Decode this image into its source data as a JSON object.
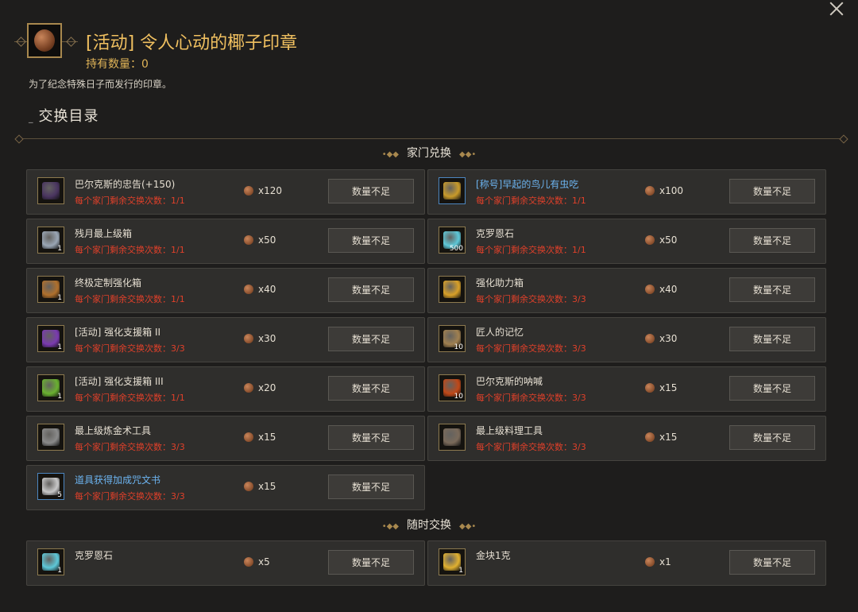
{
  "header": {
    "title": "[活动] 令人心动的椰子印章",
    "count_label": "持有数量：0",
    "description": "为了纪念特殊日子而发行的印章。",
    "icon": "coconut-seal-icon"
  },
  "section": {
    "title": "交换目录"
  },
  "groups": {
    "family": {
      "title": "家门兑换"
    },
    "anytime": {
      "title": "随时交换"
    }
  },
  "items": [
    {
      "name": "巴尔克斯的忠告(+150)",
      "remain": "每个家门剩余交换次数：1/1",
      "cost": "x120",
      "button": "数量不足",
      "badge": "",
      "icon": "scroll-icon",
      "highlight": false,
      "color": "#4a3560"
    },
    {
      "name": "[称号]早起的鸟儿有虫吃",
      "remain": "每个家门剩余交换次数：1/1",
      "cost": "x100",
      "button": "数量不足",
      "badge": "",
      "icon": "ticket-icon",
      "highlight": true,
      "color": "#c89a2a"
    },
    {
      "name": "残月最上级箱",
      "remain": "每个家门剩余交换次数：1/1",
      "cost": "x50",
      "button": "数量不足",
      "badge": "1",
      "icon": "silver-box-icon",
      "highlight": false,
      "color": "#9aa6b4"
    },
    {
      "name": "克罗恩石",
      "remain": "每个家门剩余交换次数：1/1",
      "cost": "x50",
      "button": "数量不足",
      "badge": "500",
      "icon": "crystal-icon",
      "highlight": false,
      "color": "#5ec8d8"
    },
    {
      "name": "终极定制强化箱",
      "remain": "每个家门剩余交换次数：1/1",
      "cost": "x40",
      "button": "数量不足",
      "badge": "1",
      "icon": "chest-icon",
      "highlight": false,
      "color": "#b0702c"
    },
    {
      "name": "强化助力箱",
      "remain": "每个家门剩余交换次数：3/3",
      "cost": "x40",
      "button": "数量不足",
      "badge": "",
      "icon": "gift-box-icon",
      "highlight": false,
      "color": "#d8a028"
    },
    {
      "name": "[活动] 强化支援箱 II",
      "remain": "每个家门剩余交换次数：3/3",
      "cost": "x30",
      "button": "数量不足",
      "badge": "1",
      "icon": "purple-box-icon",
      "highlight": false,
      "color": "#7a3ab0"
    },
    {
      "name": "匠人的记忆",
      "remain": "每个家门剩余交换次数：3/3",
      "cost": "x30",
      "button": "数量不足",
      "badge": "10",
      "icon": "necklace-icon",
      "highlight": false,
      "color": "#a08050"
    },
    {
      "name": "[活动] 强化支援箱 III",
      "remain": "每个家门剩余交换次数：1/1",
      "cost": "x20",
      "button": "数量不足",
      "badge": "1",
      "icon": "green-box-icon",
      "highlight": false,
      "color": "#6ab030"
    },
    {
      "name": "巴尔克斯的呐喊",
      "remain": "每个家门剩余交换次数：3/3",
      "cost": "x15",
      "button": "数量不足",
      "badge": "10",
      "icon": "orb-icon",
      "highlight": false,
      "color": "#c04818"
    },
    {
      "name": "最上级炼金术工具",
      "remain": "每个家门剩余交换次数：3/3",
      "cost": "x15",
      "button": "数量不足",
      "badge": "",
      "icon": "alchemy-tool-icon",
      "highlight": false,
      "color": "#8a8a8a"
    },
    {
      "name": "最上级料理工具",
      "remain": "每个家门剩余交换次数：3/3",
      "cost": "x15",
      "button": "数量不足",
      "badge": "",
      "icon": "cooking-tool-icon",
      "highlight": false,
      "color": "#7a6a5a"
    },
    {
      "name": "道具获得加成咒文书",
      "remain": "每个家门剩余交换次数：3/3",
      "cost": "x15",
      "button": "数量不足",
      "badge": "5",
      "icon": "spell-book-icon",
      "highlight": true,
      "color": "#c8c8c8"
    }
  ],
  "anytime_items": [
    {
      "name": "克罗恩石",
      "cost": "x5",
      "button": "数量不足",
      "badge": "1",
      "icon": "crystal-icon",
      "color": "#5ec8d8"
    },
    {
      "name": "金块1克",
      "cost": "x1",
      "button": "数量不足",
      "badge": "1",
      "icon": "gold-bar-icon",
      "color": "#e0b030"
    }
  ]
}
